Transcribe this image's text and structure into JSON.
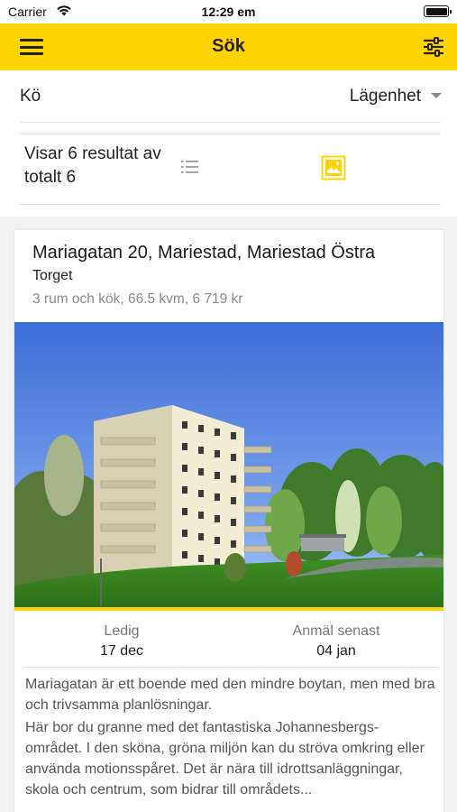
{
  "status_bar": {
    "carrier": "Carrier",
    "time": "12:29 em"
  },
  "nav": {
    "title": "Sök",
    "menu_icon": "hamburger-menu-icon",
    "filter_icon": "sliders-icon",
    "accent_color": "#ffd400"
  },
  "filters": {
    "queue_label": "Kö",
    "type_value": "Lägenhet"
  },
  "results": {
    "count_text": "Visar 6 resultat av totalt 6",
    "list_view_icon": "list-icon",
    "image_view_icon": "image-icon"
  },
  "listing": {
    "address": "Mariagatan 20, Mariestad, Mariestad Östra",
    "area": "Torget",
    "details": "3 rum och kök, 66.5 kvm, 6 719 kr",
    "available_label": "Ledig",
    "available_date": "17 dec",
    "apply_label": "Anmäl senast",
    "apply_date": "04 jan",
    "description_1": "Mariagatan är ett boende med den mindre boytan, men med bra och trivsamma planlösningar.",
    "description_2": "Här bor du granne med det fantastiska Johannesbergs-området. I den sköna, gröna miljön kan du ströva omkring eller använda motionsspåret. Det är nära till idrottsanläggningar, skola och centrum, som bidrar till områdets..."
  }
}
